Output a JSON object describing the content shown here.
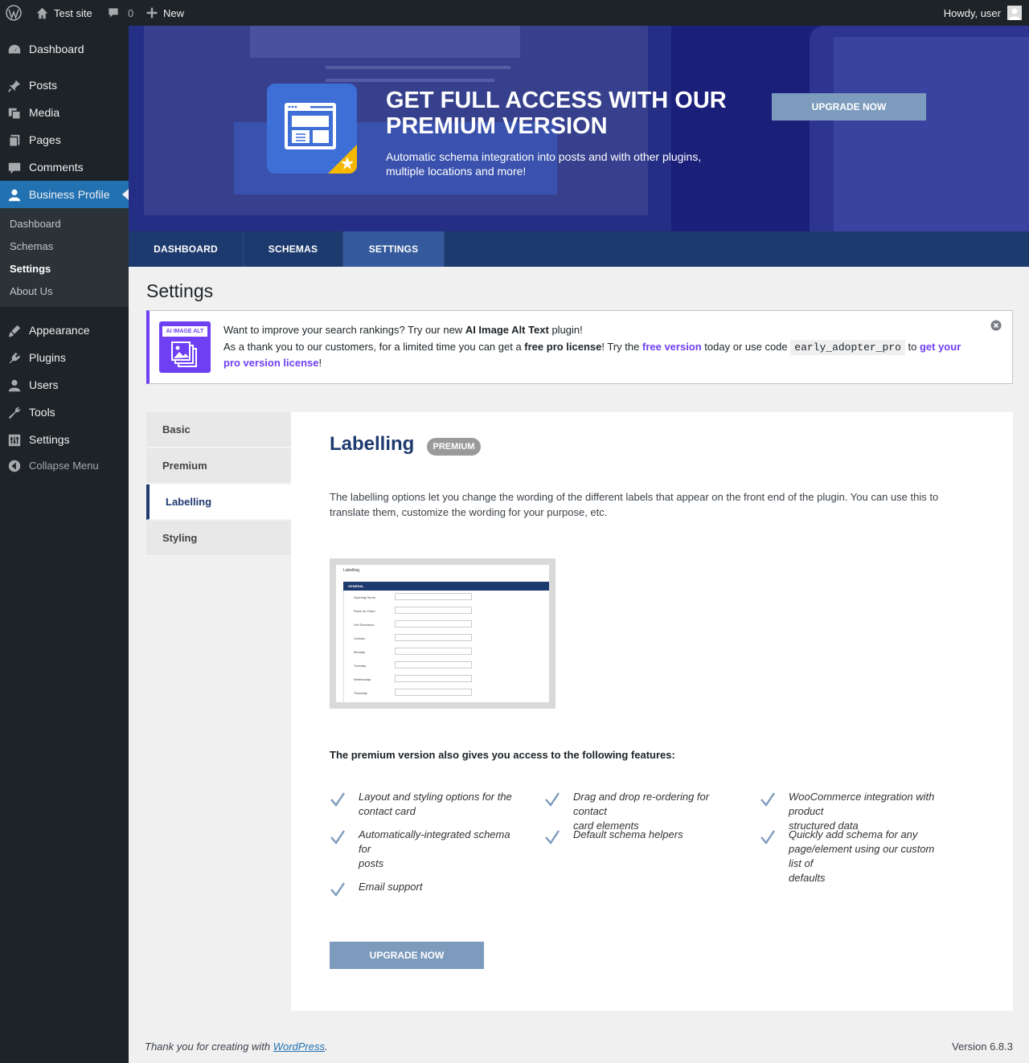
{
  "adminbar": {
    "site": "Test site",
    "comments_count": "0",
    "new_label": "New",
    "greeting": "Howdy, user"
  },
  "sidebar": {
    "items": [
      "Dashboard",
      "Posts",
      "Media",
      "Pages",
      "Comments",
      "Business Profile",
      "Appearance",
      "Plugins",
      "Users",
      "Tools",
      "Settings",
      "Collapse Menu"
    ],
    "submenu": [
      "Dashboard",
      "Schemas",
      "Settings",
      "About Us"
    ]
  },
  "banner": {
    "title_line1": "GET FULL ACCESS WITH OUR",
    "title_line2": "PREMIUM VERSION",
    "subtitle_line1": "Automatic schema integration into posts and with other plugins,",
    "subtitle_line2": "multiple locations and more!",
    "button": "UPGRADE NOW"
  },
  "tabs": [
    "DASHBOARD",
    "SCHEMAS",
    "SETTINGS"
  ],
  "page_title": "Settings",
  "notice": {
    "badge_text": "AI IMAGE ALT TEXT",
    "line1_pre": "Want to improve your search rankings? Try our new ",
    "line1_bold": "AI Image Alt Text",
    "line1_post": " plugin!",
    "line2_pre": "As a thank you to our customers, for a limited time you can get a ",
    "line2_bold": "free pro license",
    "line2_mid": "! Try the ",
    "line2_link1": "free version",
    "line2_mid2": " today or use code ",
    "code": "early_adopter_pro",
    "line2_mid3": " to ",
    "link2_part1": "get your",
    "link2_part2": "pro version license",
    "line3_post": "!"
  },
  "vtabs": [
    "Basic",
    "Premium",
    "Labelling",
    "Styling"
  ],
  "section": {
    "title": "Labelling",
    "badge": "PREMIUM",
    "desc_line1": "The labelling options let you change the wording of the different labels that appear on the front end of the plugin. You can use this to",
    "desc_line2": "translate them, customize the wording for your purpose, etc.",
    "preview": {
      "title": "Labelling",
      "header": "GENERAL",
      "rows": [
        "Opening Hours",
        "Place an Order",
        "Get Directions",
        "Contact",
        "Monday",
        "Tuesday",
        "Wednesday",
        "Thursday"
      ]
    },
    "features_heading": "The premium version also gives you access to the following features:",
    "features": [
      [
        "Layout and styling options for the",
        "contact card"
      ],
      [
        "Drag and drop re-ordering for contact",
        "card elements"
      ],
      [
        "WooCommerce integration with product",
        "structured data"
      ],
      [
        "Automatically-integrated schema for",
        "posts"
      ],
      [
        "Default schema helpers"
      ],
      [
        "Quickly add schema for any",
        "page/element using our custom list of",
        "defaults"
      ],
      [
        "Email support"
      ]
    ],
    "button": "UPGRADE NOW"
  },
  "footer": {
    "thanks_pre": "Thank you for creating with ",
    "thanks_link": "WordPress",
    "thanks_post": ".",
    "version": "Version 6.8.3"
  }
}
